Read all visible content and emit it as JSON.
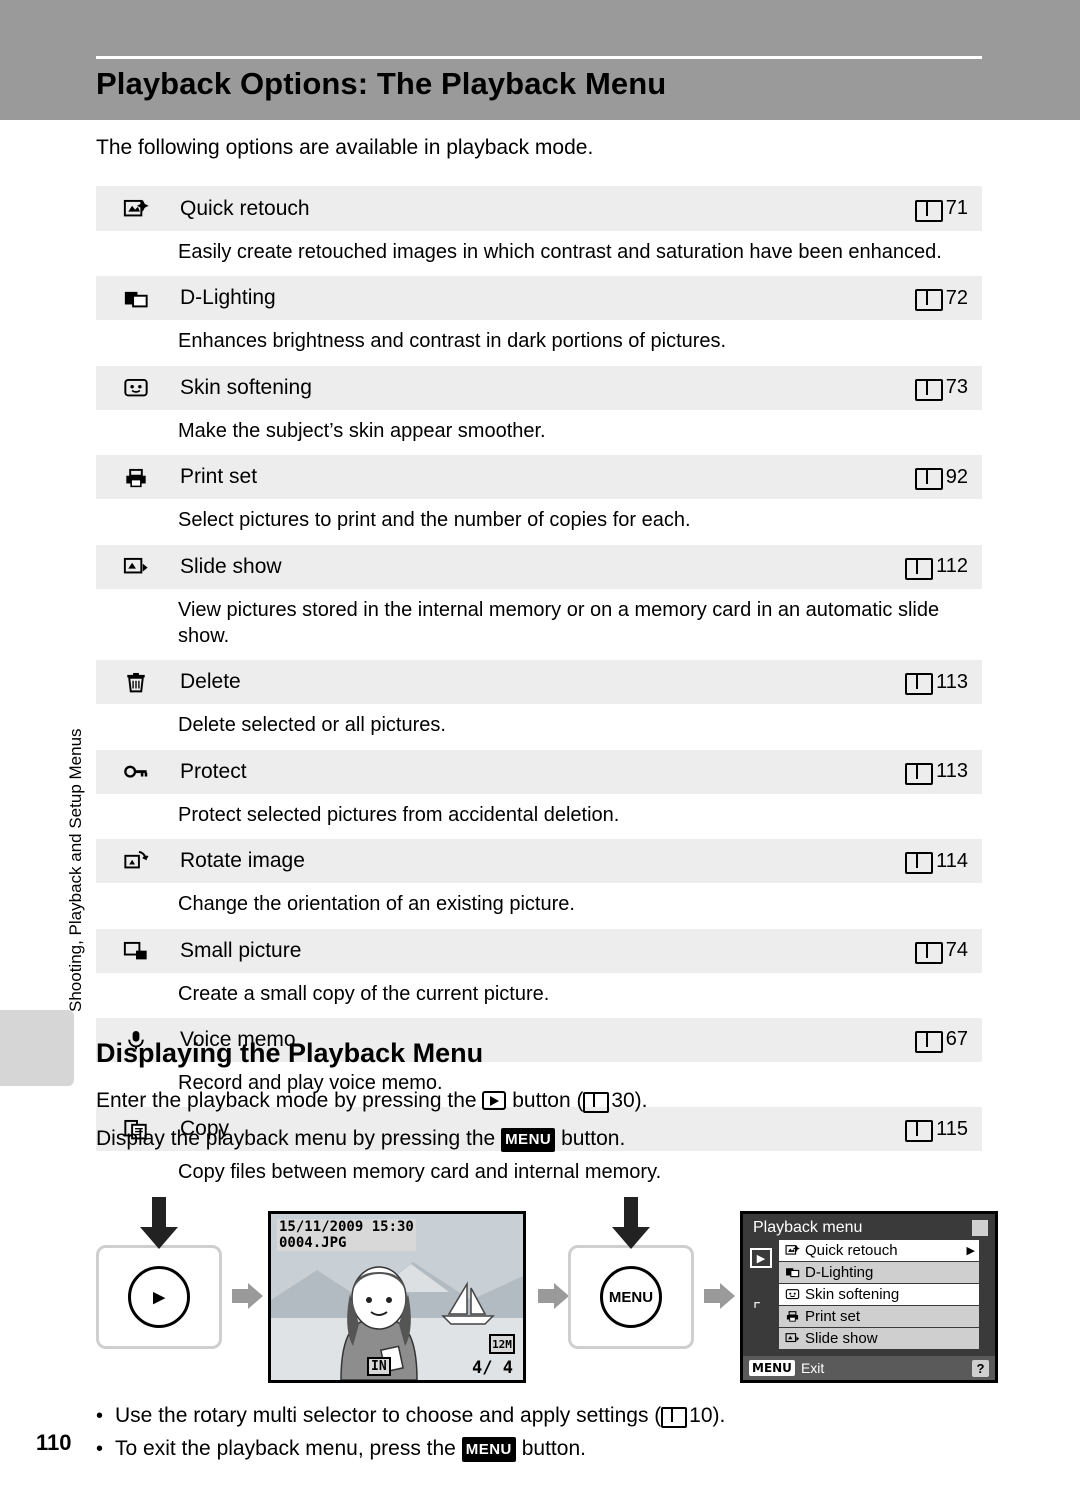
{
  "header": {
    "title": "Playback Options: The Playback Menu"
  },
  "side_tab": {
    "label": "Shooting, Playback and Setup Menus"
  },
  "intro": "The following options are available in playback mode.",
  "menu": {
    "items": [
      {
        "icon": "quick-retouch-icon",
        "label": "Quick retouch",
        "ref": "71",
        "desc": "Easily create retouched images in which contrast and saturation have been enhanced."
      },
      {
        "icon": "d-lighting-icon",
        "label": "D-Lighting",
        "ref": "72",
        "desc": "Enhances brightness and contrast in dark portions of pictures."
      },
      {
        "icon": "skin-softening-icon",
        "label": "Skin softening",
        "ref": "73",
        "desc": "Make the subject’s skin appear smoother."
      },
      {
        "icon": "print-set-icon",
        "label": "Print set",
        "ref": "92",
        "desc": "Select pictures to print and the number of copies for each."
      },
      {
        "icon": "slide-show-icon",
        "label": "Slide show",
        "ref": "112",
        "desc": "View pictures stored in the internal memory or on a memory card in an automatic slide show."
      },
      {
        "icon": "delete-trash-icon",
        "label": "Delete",
        "ref": "113",
        "desc": "Delete selected or all pictures."
      },
      {
        "icon": "protect-key-icon",
        "label": "Protect",
        "ref": "113",
        "desc": "Protect selected pictures from accidental deletion."
      },
      {
        "icon": "rotate-image-icon",
        "label": "Rotate image",
        "ref": "114",
        "desc": "Change the orientation of an existing picture."
      },
      {
        "icon": "small-picture-icon",
        "label": "Small picture",
        "ref": "74",
        "desc": "Create a small copy of the current picture."
      },
      {
        "icon": "voice-memo-mic-icon",
        "label": "Voice memo",
        "ref": "67",
        "desc": "Record and play voice memo."
      },
      {
        "icon": "copy-icon",
        "label": "Copy",
        "ref": "115",
        "desc": "Copy files between memory card and internal memory."
      }
    ]
  },
  "section2": {
    "heading": "Displaying the Playback Menu",
    "line1_a": "Enter the playback mode by pressing the",
    "line1_b": "button (",
    "line1_c": "30).",
    "line2_a": "Display the playback menu by pressing the",
    "line2_badge": "MENU",
    "line2_b": "button."
  },
  "figure": {
    "playback_button_label": "▶",
    "menu_button_label": "MENU",
    "lcd": {
      "date": "15/11/2009 15:30",
      "file": "0004.JPG",
      "image_size": "12M",
      "battery": "IN",
      "counter": "4/  4"
    },
    "menu_screen": {
      "title": "Playback menu",
      "items": [
        {
          "icon": "quick-retouch-icon",
          "label": "Quick retouch",
          "selected": true
        },
        {
          "icon": "d-lighting-icon",
          "label": "D-Lighting",
          "selected": false
        },
        {
          "icon": "skin-softening-icon",
          "label": "Skin softening",
          "selected": true
        },
        {
          "icon": "print-set-icon",
          "label": "Print set",
          "selected": false
        },
        {
          "icon": "slide-show-icon",
          "label": "Slide show",
          "selected": false
        }
      ],
      "exit_badge": "MENU",
      "exit_label": "Exit",
      "help_badge": "?"
    }
  },
  "bullets": {
    "b1_a": "Use the rotary multi selector to choose and apply settings (",
    "b1_b": "10).",
    "b2_a": "To exit the playback menu, press the",
    "b2_badge": "MENU",
    "b2_b": "button."
  },
  "page_number": "110"
}
